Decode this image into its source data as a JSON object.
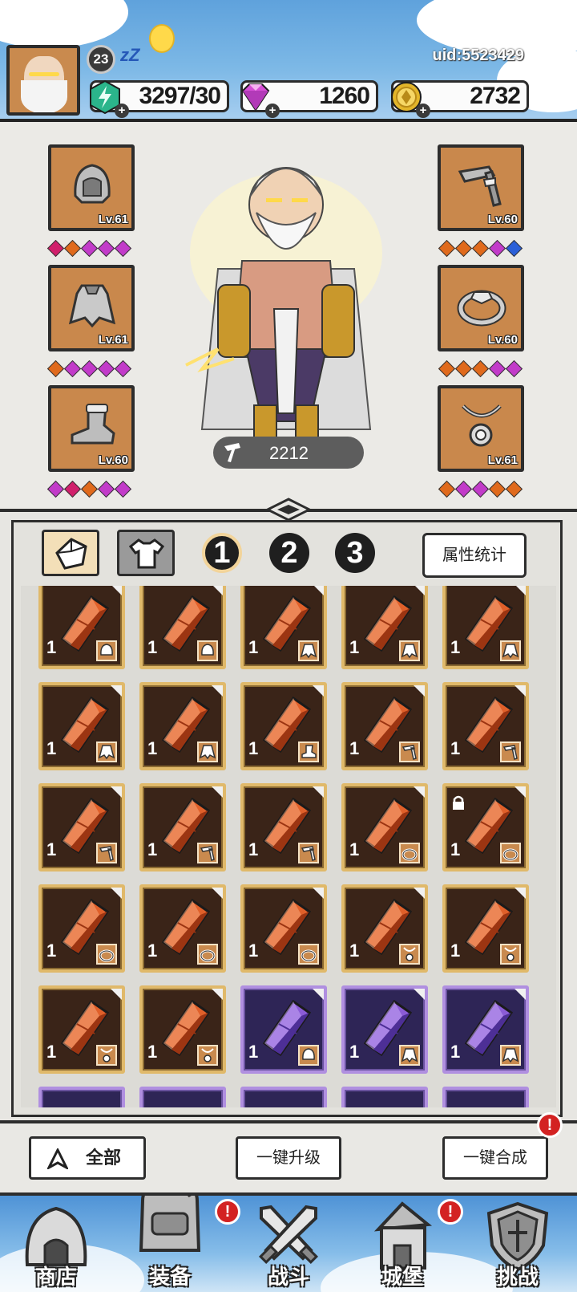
{
  "header": {
    "level": "23",
    "uid": "uid:5523429",
    "energy": "3297/30",
    "gems": "1260",
    "gold": "2732"
  },
  "equipment": {
    "slots": [
      {
        "name": "helmet",
        "level": "Lv.61",
        "gems": [
          "#d11f6b",
          "#e06a1c",
          "#c23bc9",
          "#c23bc9",
          "#c23bc9"
        ]
      },
      {
        "name": "armor",
        "level": "Lv.61",
        "gems": [
          "#e06a1c",
          "#c23bc9",
          "#c23bc9",
          "#c23bc9",
          "#c23bc9"
        ]
      },
      {
        "name": "boots",
        "level": "Lv.60",
        "gems": [
          "#c23bc9",
          "#d11f6b",
          "#e06a1c",
          "#c23bc9",
          "#c23bc9"
        ]
      },
      {
        "name": "weapon",
        "level": "Lv.60",
        "gems": [
          "#e06a1c",
          "#e06a1c",
          "#e06a1c",
          "#c23bc9",
          "#2a5fd8"
        ]
      },
      {
        "name": "ring",
        "level": "Lv.60",
        "gems": [
          "#e06a1c",
          "#e06a1c",
          "#e06a1c",
          "#c23bc9",
          "#c23bc9"
        ]
      },
      {
        "name": "necklace",
        "level": "Lv.61",
        "gems": [
          "#e06a1c",
          "#c23bc9",
          "#c23bc9",
          "#e06a1c",
          "#e06a1c"
        ]
      }
    ],
    "power": "2212"
  },
  "bag": {
    "tabs": [
      "crystal-tab",
      "equipment-tab"
    ],
    "pages": [
      "1",
      "2",
      "3"
    ],
    "stats_label": "属性统计",
    "items": [
      {
        "type": "orange",
        "count": "1",
        "slot": "helmet-badge-icon"
      },
      {
        "type": "orange",
        "count": "1",
        "slot": "helmet-badge-icon"
      },
      {
        "type": "orange",
        "count": "1",
        "slot": "armor-badge-icon"
      },
      {
        "type": "orange",
        "count": "1",
        "slot": "armor-badge-icon"
      },
      {
        "type": "orange",
        "count": "1",
        "slot": "armor-badge-icon"
      },
      {
        "type": "orange",
        "count": "1",
        "slot": "armor-badge-icon"
      },
      {
        "type": "orange",
        "count": "1",
        "slot": "armor-badge-icon"
      },
      {
        "type": "orange",
        "count": "1",
        "slot": "boots-badge-icon"
      },
      {
        "type": "orange",
        "count": "1",
        "slot": "weapon-badge-icon"
      },
      {
        "type": "orange",
        "count": "1",
        "slot": "weapon-badge-icon"
      },
      {
        "type": "orange",
        "count": "1",
        "slot": "weapon-badge-icon"
      },
      {
        "type": "orange",
        "count": "1",
        "slot": "weapon-badge-icon"
      },
      {
        "type": "orange",
        "count": "1",
        "slot": "weapon-badge-icon"
      },
      {
        "type": "orange",
        "count": "1",
        "slot": "ring-badge-icon"
      },
      {
        "type": "orange",
        "count": "1",
        "slot": "ring-badge-icon",
        "locked": true
      },
      {
        "type": "orange",
        "count": "1",
        "slot": "ring-badge-icon"
      },
      {
        "type": "orange",
        "count": "1",
        "slot": "ring-badge-icon"
      },
      {
        "type": "orange",
        "count": "1",
        "slot": "ring-badge-icon"
      },
      {
        "type": "orange",
        "count": "1",
        "slot": "necklace-badge-icon"
      },
      {
        "type": "orange",
        "count": "1",
        "slot": "necklace-badge-icon"
      },
      {
        "type": "orange",
        "count": "1",
        "slot": "necklace-badge-icon"
      },
      {
        "type": "orange",
        "count": "1",
        "slot": "necklace-badge-icon"
      },
      {
        "type": "purple",
        "count": "1",
        "slot": "helmet-badge-icon"
      },
      {
        "type": "purple",
        "count": "1",
        "slot": "armor-badge-icon"
      },
      {
        "type": "purple",
        "count": "1",
        "slot": "armor-badge-icon"
      }
    ]
  },
  "actions": {
    "filter_all": "全部",
    "upgrade_all": "一键升级",
    "merge_all": "一键合成"
  },
  "nav": {
    "items": [
      "商店",
      "装备",
      "战斗",
      "城堡",
      "挑战"
    ]
  },
  "colors": {
    "orange_crystal": "#e0602a",
    "purple_crystal": "#8b5cd6"
  }
}
